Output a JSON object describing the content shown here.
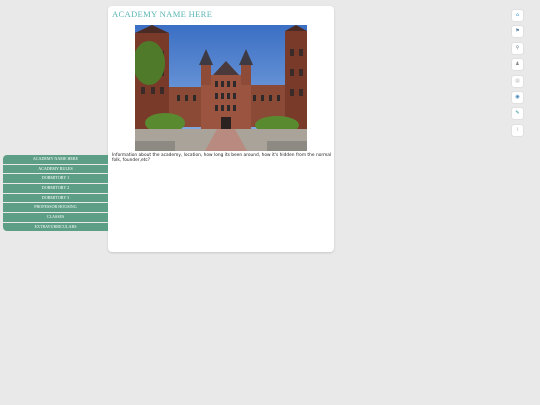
{
  "page": {
    "title": "ACADEMY NAME HERE",
    "description": "Information about the academy, location, how long its been around, how it's hidden from the normal folk, founder,etc?"
  },
  "hero_image": {
    "alt": "",
    "icon": "academy-building-photo"
  },
  "sidebar": {
    "items": [
      {
        "label": "ACADEMY NAME HERE"
      },
      {
        "label": "ACADEMY RULES"
      },
      {
        "label": "DORMITORY 1"
      },
      {
        "label": "DORMITORY 2"
      },
      {
        "label": "DORMITORY 3"
      },
      {
        "label": "PROFESSOR HOUSING"
      },
      {
        "label": "CLASSES"
      },
      {
        "label": "EXTRAVURRICULARS"
      }
    ],
    "color": "#5c9f86"
  },
  "social_bar": {
    "icons": [
      {
        "icon": "home-icon",
        "glyph": "⌂",
        "color": "#3a9ad9"
      },
      {
        "icon": "flag-icon",
        "glyph": "⚑",
        "color": "#5b7fa6"
      },
      {
        "icon": "search-icon",
        "glyph": "⚲",
        "color": "#6a7f8f"
      },
      {
        "icon": "person-icon",
        "glyph": "♟",
        "color": "#8a8a8a"
      },
      {
        "icon": "calendar-icon",
        "glyph": "▦",
        "color": "#c9c9c9"
      },
      {
        "icon": "eye-icon",
        "glyph": "◉",
        "color": "#3a7fb0"
      },
      {
        "icon": "pencil-icon",
        "glyph": "✎",
        "color": "#2f8a9d"
      },
      {
        "icon": "info-icon",
        "glyph": "i",
        "color": "#b0b0b0"
      }
    ]
  },
  "colors": {
    "background": "#e9e9e9",
    "card": "#ffffff",
    "title": "#5bb6b6",
    "nav": "#5c9f86"
  }
}
